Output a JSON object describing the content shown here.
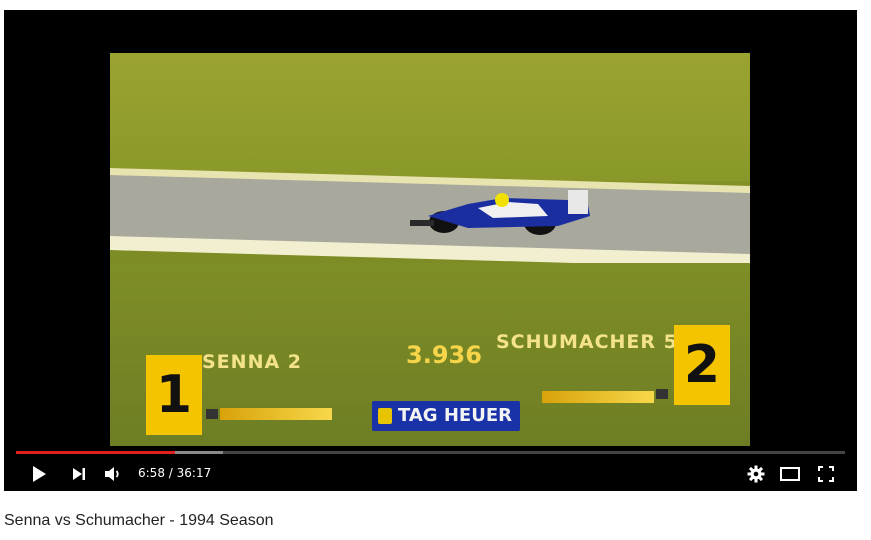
{
  "player": {
    "progress": {
      "played_fraction": 0.192,
      "buffered_fraction": 0.25
    },
    "time": {
      "current": "6:58",
      "total": "36:17",
      "separator": "/"
    },
    "controls": {
      "play_icon": "play-icon",
      "next_icon": "next-icon",
      "volume_icon": "volume-icon",
      "settings_icon": "gear-icon",
      "theater_icon": "theater-mode-icon",
      "fullscreen_icon": "fullscreen-icon"
    },
    "colors": {
      "progress_played": "#e02020",
      "controls_bg": "#000000"
    }
  },
  "video_frame": {
    "graphic": {
      "left_position": "1",
      "left_driver": "SENNA 2",
      "gap": "3.936",
      "right_driver": "SCHUMACHER 5",
      "right_position": "2",
      "sponsor": "TAG HEUER"
    }
  },
  "video": {
    "title": "Senna vs Schumacher - 1994 Season"
  }
}
